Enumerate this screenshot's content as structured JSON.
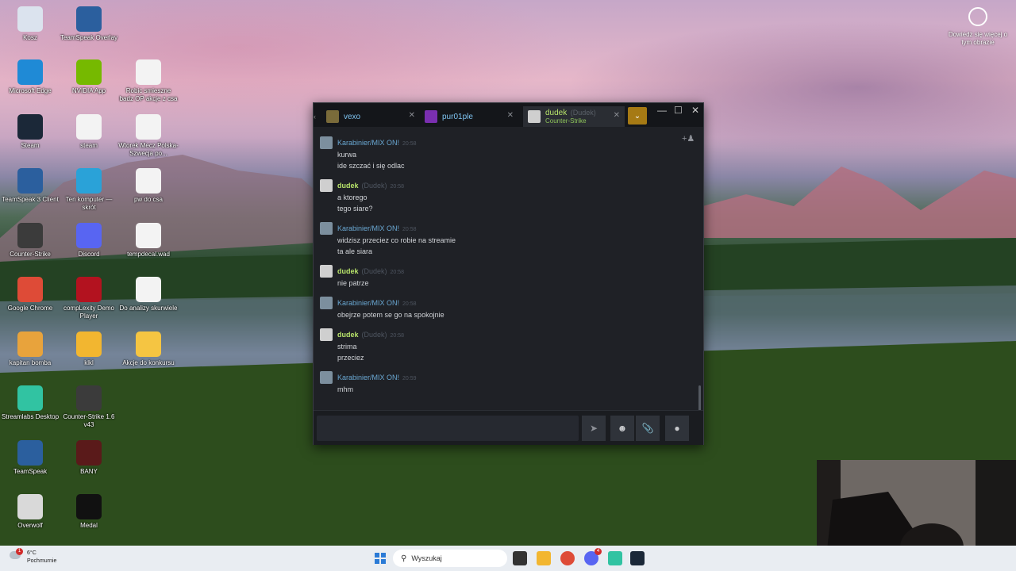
{
  "desktop_icons": [
    {
      "label": "Kosz",
      "icon": "recycle-bin-icon",
      "color": "#dbe3ee"
    },
    {
      "label": "TeamSpeak Overlay",
      "icon": "teamspeak-icon",
      "color": "#2b5f9e"
    },
    {
      "label": "Microsoft Edge",
      "icon": "edge-icon",
      "color": "#1f8ad6"
    },
    {
      "label": "NVIDIA App",
      "icon": "nvidia-icon",
      "color": "#76b900"
    },
    {
      "label": "Robic smieszne badz OP akcje z csa",
      "icon": "text-file-icon",
      "color": "#f3f3f3"
    },
    {
      "label": "Steam",
      "icon": "steam-icon",
      "color": "#1b2838"
    },
    {
      "label": "steam",
      "icon": "text-file-icon",
      "color": "#f3f3f3"
    },
    {
      "label": "Wtorek Mecz Polska-Szwecja po...",
      "icon": "text-file-icon",
      "color": "#f3f3f3"
    },
    {
      "label": "TeamSpeak 3 Client",
      "icon": "teamspeak-icon",
      "color": "#2b5f9e"
    },
    {
      "label": "Ten komputer — skrót",
      "icon": "computer-icon",
      "color": "#2aa2d8"
    },
    {
      "label": "pw do csa",
      "icon": "text-file-icon",
      "color": "#f3f3f3"
    },
    {
      "label": "Counter-Strike",
      "icon": "counter-strike-icon",
      "color": "#3b3b3b"
    },
    {
      "label": "Discord",
      "icon": "discord-icon",
      "color": "#5865f2"
    },
    {
      "label": "tempdecal.wad",
      "icon": "file-icon",
      "color": "#f3f3f3"
    },
    {
      "label": "Google Chrome",
      "icon": "chrome-icon",
      "color": "#de4b37"
    },
    {
      "label": "compLexity Demo Player",
      "icon": "demo-player-icon",
      "color": "#b3121f"
    },
    {
      "label": "Do analizy skurwiele",
      "icon": "text-file-icon",
      "color": "#f3f3f3"
    },
    {
      "label": "kapitan bomba",
      "icon": "game-icon",
      "color": "#e8a33c"
    },
    {
      "label": "klkl",
      "icon": "folder-icon",
      "color": "#f2b630"
    },
    {
      "label": "Akcje do konkursu",
      "icon": "folder-icon",
      "color": "#f5c542"
    },
    {
      "label": "Streamlabs Desktop",
      "icon": "streamlabs-icon",
      "color": "#31c3a2"
    },
    {
      "label": "Counter-Strike 1.6 v43",
      "icon": "counter-strike-icon",
      "color": "#3b3b3b"
    },
    {
      "label": "TeamSpeak",
      "icon": "teamspeak-icon",
      "color": "#2b5f9e"
    },
    {
      "label": "BANY",
      "icon": "image-icon",
      "color": "#5a1a1a"
    },
    {
      "label": "Overwolf",
      "icon": "overwolf-icon",
      "color": "#d9d9d9"
    },
    {
      "label": "Medal",
      "icon": "medal-icon",
      "color": "#111111"
    }
  ],
  "top_right_widget": {
    "label": "Dowiedz się więcej o tym obrazie",
    "icon": "camera-icon"
  },
  "chat": {
    "tabs": [
      {
        "name": "vexo",
        "icon": "vexo-avatar",
        "color": "#7a6b3a"
      },
      {
        "name": "pur01ple",
        "icon": "pur01ple-avatar",
        "color": "#7a2fb0"
      },
      {
        "name": "dudek",
        "nickname": "(Dudek)",
        "game": "Counter-Strike",
        "icon": "dudek-avatar",
        "color": "#cfcfcf"
      }
    ],
    "dropdown_icon": "chevron-down-icon",
    "add_friend_icon": "add-friend-icon",
    "messages": [
      {
        "author": "Karabinier/MIX ON!",
        "nick": "",
        "time": "20:58",
        "kind": "friend",
        "lines": [
          "kurwa",
          "ide szczać i się odlac"
        ]
      },
      {
        "author": "dudek",
        "nick": "(Dudek)",
        "time": "20:58",
        "kind": "self",
        "lines": [
          "a ktorego",
          "tego siare?"
        ]
      },
      {
        "author": "Karabinier/MIX ON!",
        "nick": "",
        "time": "20:58",
        "kind": "friend",
        "lines": [
          "widzisz przeciez co robie na streamie",
          "ta ale siara"
        ]
      },
      {
        "author": "dudek",
        "nick": "(Dudek)",
        "time": "20:58",
        "kind": "self",
        "lines": [
          "nie patrze"
        ]
      },
      {
        "author": "Karabinier/MIX ON!",
        "nick": "",
        "time": "20:58",
        "kind": "friend",
        "lines": [
          "obejrze potem se go na spokojnie"
        ]
      },
      {
        "author": "dudek",
        "nick": "(Dudek)",
        "time": "20:58",
        "kind": "self",
        "lines": [
          "strima",
          "przeciez"
        ]
      },
      {
        "author": "Karabinier/MIX ON!",
        "nick": "",
        "time": "20:59",
        "kind": "friend",
        "lines": [
          "mhm"
        ]
      }
    ],
    "buttons": {
      "send_icon": "send-icon",
      "emoji_icon": "emoji-icon",
      "attach_icon": "attachment-icon",
      "voice_icon": "voice-icon"
    }
  },
  "taskbar": {
    "weather_temp": "6°C",
    "weather_desc": "Pochmurnie",
    "weather_badge": "1",
    "search_placeholder": "Wyszukaj",
    "discord_badge": "4",
    "apps": [
      "windows-start-icon",
      "search-icon",
      "task-view-icon",
      "file-explorer-icon",
      "chrome-icon",
      "discord-icon",
      "streamlabs-icon",
      "steam-icon"
    ]
  }
}
